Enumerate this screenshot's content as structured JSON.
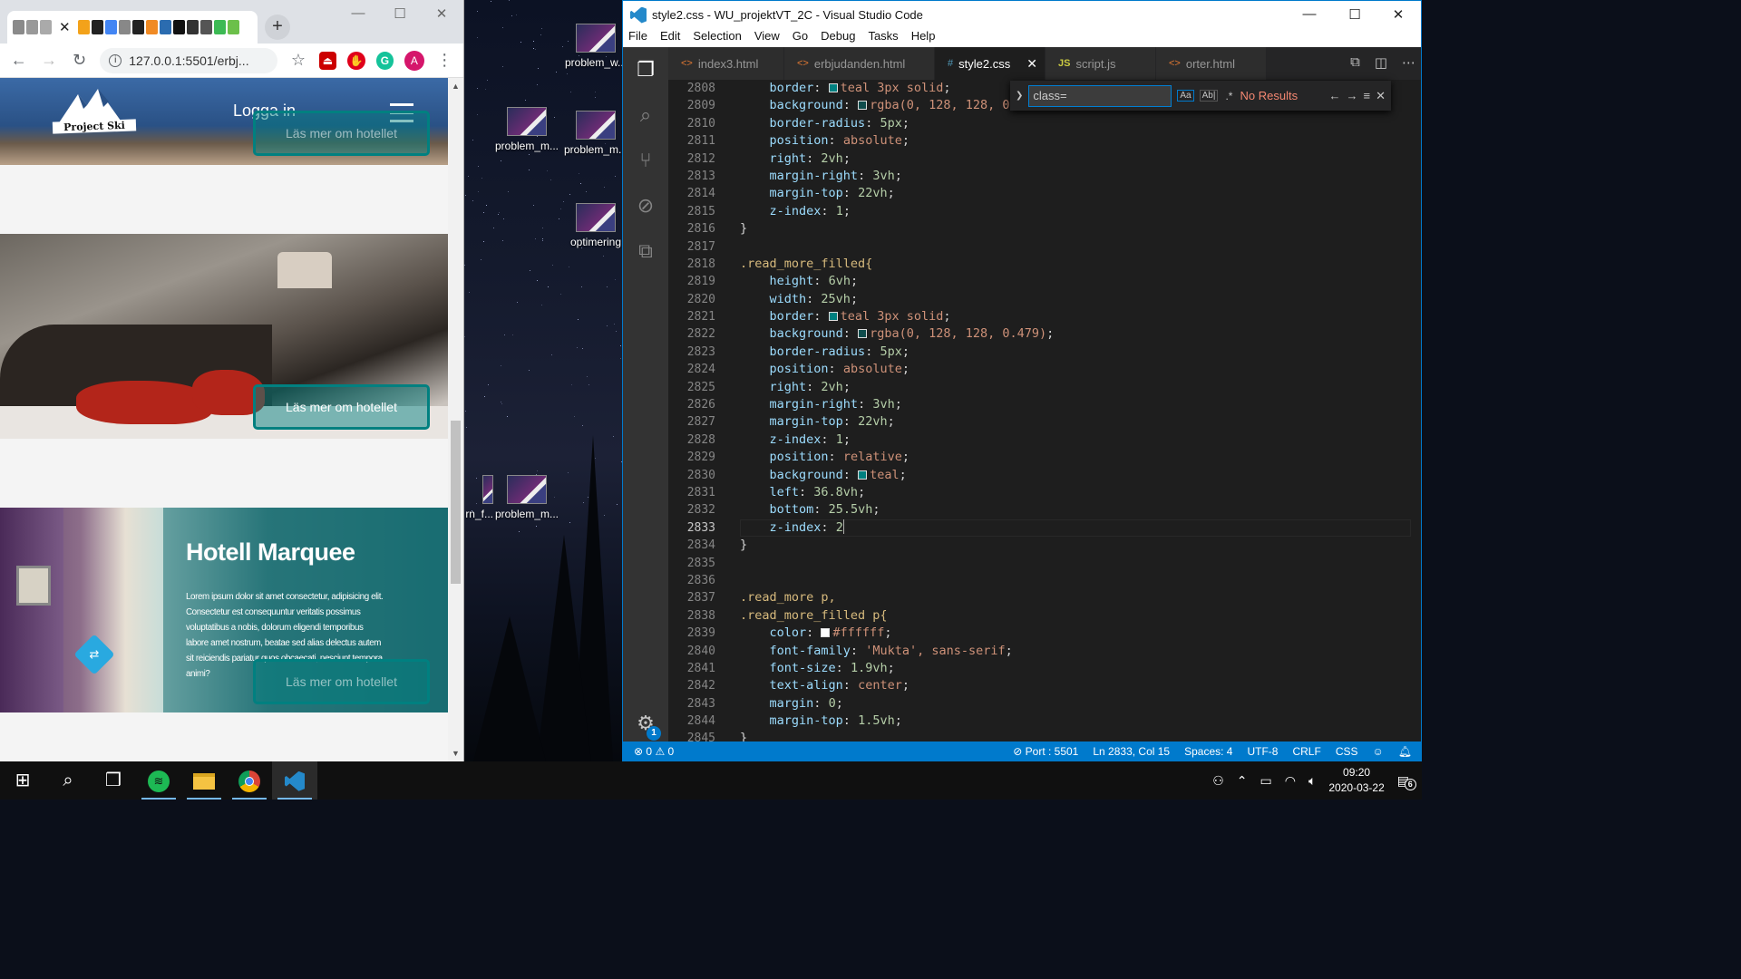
{
  "browser": {
    "tab_title": "",
    "url": "127.0.0.1:5501/erbj...",
    "avatar_letter": "A",
    "page": {
      "logo_text": "Project Ski",
      "login_label": "Logga in",
      "read_more_label": "Läs mer om hotellet",
      "hotel_title": "Hotell Marquee",
      "hotel_text": "Lorem ipsum dolor sit amet consectetur, adipisicing elit. Consectetur est consequuntur veritatis possimus voluptatibus a nobis, dolorum eligendi temporibus labore amet nostrum, beatae sed alias delectus autem sit reiciendis pariatur quos obcaecati, nesciunt tempora animi?"
    }
  },
  "desktop": {
    "icons": [
      "problem_w...",
      "problem_m...",
      "problem_m...",
      "optimering",
      "rn_f...",
      "problem_m..."
    ]
  },
  "vscode": {
    "window_title": "style2.css - WU_projektVT_2C - Visual Studio Code",
    "menu": [
      "File",
      "Edit",
      "Selection",
      "View",
      "Go",
      "Debug",
      "Tasks",
      "Help"
    ],
    "tabs": [
      {
        "icon": "<>",
        "label": "index3.html"
      },
      {
        "icon": "<>",
        "label": "erbjudanden.html"
      },
      {
        "icon": "#",
        "label": "style2.css"
      },
      {
        "icon": "JS",
        "label": "script.js"
      },
      {
        "icon": "<>",
        "label": "orter.html"
      }
    ],
    "find": {
      "query": "class=",
      "result": "No Results"
    },
    "line_numbers": [
      "2808",
      "2809",
      "2810",
      "2811",
      "2812",
      "2813",
      "2814",
      "2815",
      "2816",
      "2817",
      "2818",
      "2819",
      "2820",
      "2821",
      "2822",
      "2823",
      "2824",
      "2825",
      "2826",
      "2827",
      "2828",
      "2829",
      "2830",
      "2831",
      "2832",
      "2833",
      "2834",
      "2835",
      "2836",
      "2837",
      "2838",
      "2839",
      "2840",
      "2841",
      "2842",
      "2843",
      "2844",
      "2845"
    ],
    "code": [
      {
        "t": "    border: ",
        "s": "teal",
        "v": "teal 3px solid",
        "e": ";"
      },
      {
        "t": "    background: ",
        "s": "rgba(0,128,128,0.479)",
        "v": "rgba(0, 128, 128, 0.479);"
      },
      {
        "t": "    border-radius: ",
        "v": "5px",
        "e": ";"
      },
      {
        "t": "    position: ",
        "v": "absolute",
        "e": ";"
      },
      {
        "t": "    right: ",
        "v": "2vh",
        "e": ";"
      },
      {
        "t": "    margin-right: ",
        "v": "3vh",
        "e": ";"
      },
      {
        "t": "    margin-top: ",
        "v": "22vh",
        "e": ";"
      },
      {
        "t": "    z-index: ",
        "v": "1",
        "e": ";"
      },
      {
        "t": "}"
      },
      {
        "t": ""
      },
      {
        "sel": ".read_more_filled{"
      },
      {
        "t": "    height: ",
        "v": "6vh",
        "e": ";"
      },
      {
        "t": "    width: ",
        "v": "25vh",
        "e": ";"
      },
      {
        "t": "    border: ",
        "s": "teal",
        "v": "teal 3px solid",
        "e": ";"
      },
      {
        "t": "    background: ",
        "s": "rgba(0,128,128,0.479)",
        "v": "rgba(0, 128, 128, 0.479)",
        "e": ";"
      },
      {
        "t": "    border-radius: ",
        "v": "5px",
        "e": ";"
      },
      {
        "t": "    position: ",
        "v": "absolute",
        "e": ";"
      },
      {
        "t": "    right: ",
        "v": "2vh",
        "e": ";"
      },
      {
        "t": "    margin-right: ",
        "v": "3vh",
        "e": ";"
      },
      {
        "t": "    margin-top: ",
        "v": "22vh",
        "e": ";"
      },
      {
        "t": "    z-index: ",
        "v": "1",
        "e": ";"
      },
      {
        "t": "    position: ",
        "v": "relative",
        "e": ";"
      },
      {
        "t": "    background: ",
        "s": "teal",
        "v": "teal",
        "e": ";"
      },
      {
        "t": "    left: ",
        "v": "36.8vh",
        "e": ";"
      },
      {
        "t": "    bottom: ",
        "v": "25.5vh",
        "e": ";"
      },
      {
        "t": "    z-index: ",
        "v": "2",
        "cursor": true
      },
      {
        "t": "}"
      },
      {
        "t": ""
      },
      {
        "t": ""
      },
      {
        "sel": ".read_more p,"
      },
      {
        "sel": ".read_more_filled p{"
      },
      {
        "t": "    color: ",
        "s": "#ffffff",
        "v": "#ffffff",
        "e": ";"
      },
      {
        "t": "    font-family: ",
        "v": "'Mukta', sans-serif",
        "e": ";"
      },
      {
        "t": "    font-size: ",
        "v": "1.9vh",
        "e": ";"
      },
      {
        "t": "    text-align: ",
        "v": "center",
        "e": ";"
      },
      {
        "t": "    margin: ",
        "v": "0",
        "e": ";"
      },
      {
        "t": "    margin-top: ",
        "v": "1.5vh",
        "e": ";"
      },
      {
        "t": "}"
      }
    ],
    "status": {
      "errors": "0",
      "warnings": "0",
      "port": "Port : 5501",
      "position": "Ln 2833, Col 15",
      "spaces": "Spaces: 4",
      "encoding": "UTF-8",
      "eol": "CRLF",
      "language": "CSS"
    },
    "settings_badge": "1"
  },
  "taskbar": {
    "time": "09:20",
    "date": "2020-03-22",
    "notification_count": "6"
  }
}
